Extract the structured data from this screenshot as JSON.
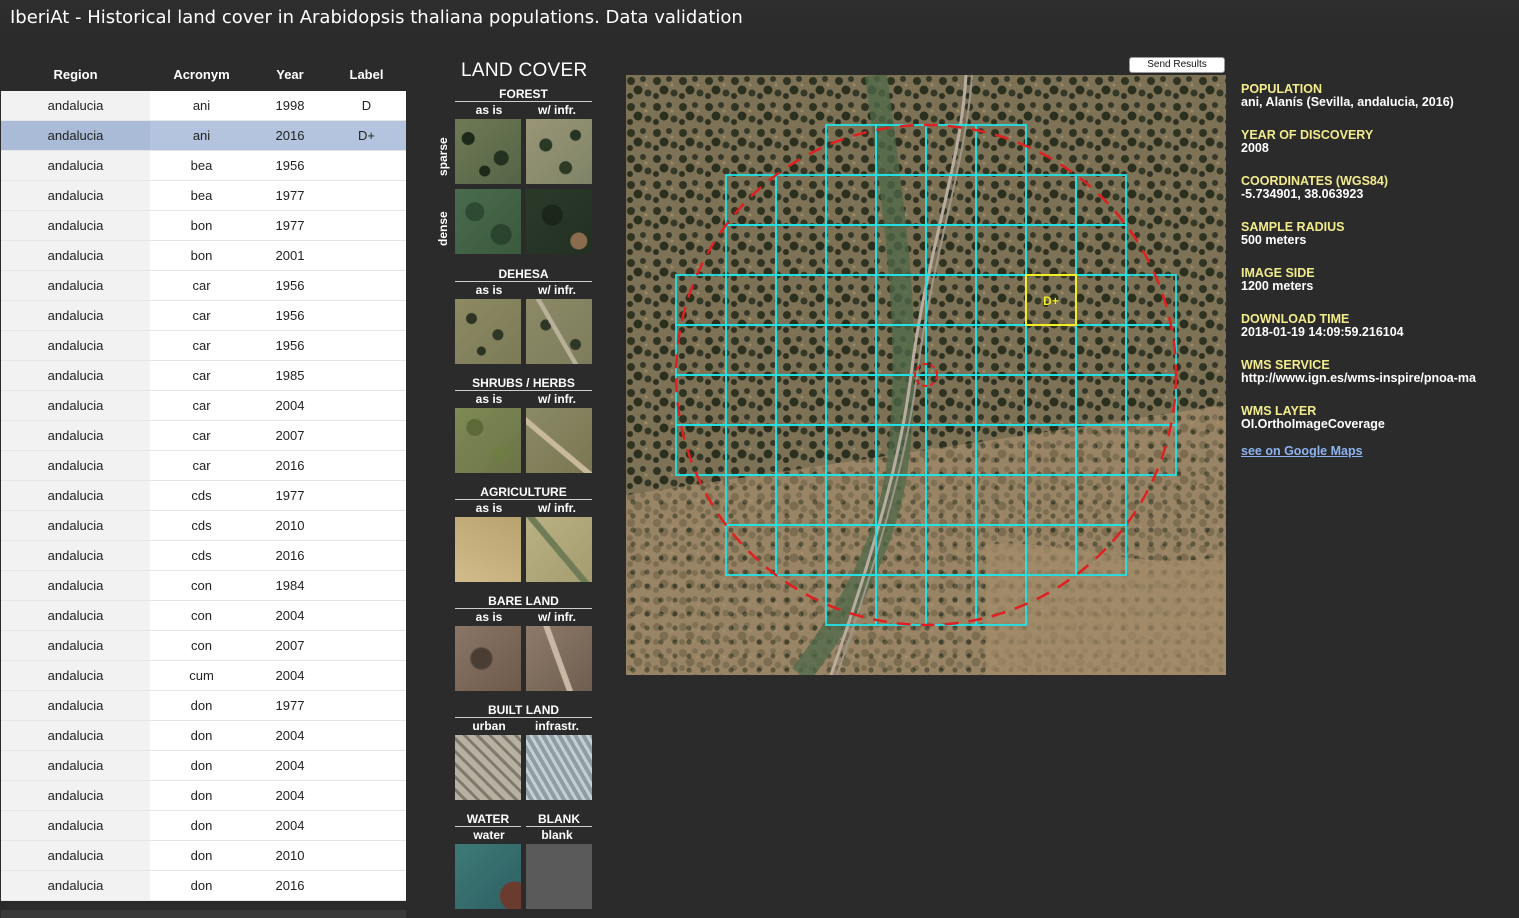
{
  "title": "IberiAt - Historical land cover in Arabidopsis thaliana populations. Data validation",
  "table": {
    "headers": {
      "region": "Region",
      "acronym": "Acronym",
      "year": "Year",
      "label": "Label"
    },
    "selected_index": 1,
    "rows": [
      {
        "region": "andalucia",
        "acronym": "ani",
        "year": "1998",
        "label": "D"
      },
      {
        "region": "andalucia",
        "acronym": "ani",
        "year": "2016",
        "label": "D+"
      },
      {
        "region": "andalucia",
        "acronym": "bea",
        "year": "1956",
        "label": ""
      },
      {
        "region": "andalucia",
        "acronym": "bea",
        "year": "1977",
        "label": ""
      },
      {
        "region": "andalucia",
        "acronym": "bon",
        "year": "1977",
        "label": ""
      },
      {
        "region": "andalucia",
        "acronym": "bon",
        "year": "2001",
        "label": ""
      },
      {
        "region": "andalucia",
        "acronym": "car",
        "year": "1956",
        "label": ""
      },
      {
        "region": "andalucia",
        "acronym": "car",
        "year": "1956",
        "label": ""
      },
      {
        "region": "andalucia",
        "acronym": "car",
        "year": "1956",
        "label": ""
      },
      {
        "region": "andalucia",
        "acronym": "car",
        "year": "1985",
        "label": ""
      },
      {
        "region": "andalucia",
        "acronym": "car",
        "year": "2004",
        "label": ""
      },
      {
        "region": "andalucia",
        "acronym": "car",
        "year": "2007",
        "label": ""
      },
      {
        "region": "andalucia",
        "acronym": "car",
        "year": "2016",
        "label": ""
      },
      {
        "region": "andalucia",
        "acronym": "cds",
        "year": "1977",
        "label": ""
      },
      {
        "region": "andalucia",
        "acronym": "cds",
        "year": "2010",
        "label": ""
      },
      {
        "region": "andalucia",
        "acronym": "cds",
        "year": "2016",
        "label": ""
      },
      {
        "region": "andalucia",
        "acronym": "con",
        "year": "1984",
        "label": ""
      },
      {
        "region": "andalucia",
        "acronym": "con",
        "year": "2004",
        "label": ""
      },
      {
        "region": "andalucia",
        "acronym": "con",
        "year": "2007",
        "label": ""
      },
      {
        "region": "andalucia",
        "acronym": "cum",
        "year": "2004",
        "label": ""
      },
      {
        "region": "andalucia",
        "acronym": "don",
        "year": "1977",
        "label": ""
      },
      {
        "region": "andalucia",
        "acronym": "don",
        "year": "2004",
        "label": ""
      },
      {
        "region": "andalucia",
        "acronym": "don",
        "year": "2004",
        "label": ""
      },
      {
        "region": "andalucia",
        "acronym": "don",
        "year": "2004",
        "label": ""
      },
      {
        "region": "andalucia",
        "acronym": "don",
        "year": "2004",
        "label": ""
      },
      {
        "region": "andalucia",
        "acronym": "don",
        "year": "2010",
        "label": ""
      },
      {
        "region": "andalucia",
        "acronym": "don",
        "year": "2016",
        "label": ""
      }
    ]
  },
  "land_cover": {
    "title": "LAND COVER",
    "row_labels": {
      "sparse": "sparse",
      "dense": "dense"
    },
    "forest": {
      "title": "FOREST",
      "sub_a": "as is",
      "sub_b": "w/ infr."
    },
    "dehesa": {
      "title": "DEHESA",
      "sub_a": "as is",
      "sub_b": "w/ infr."
    },
    "shrubs": {
      "title": "SHRUBS / HERBS",
      "sub_a": "as is",
      "sub_b": "w/ infr."
    },
    "agriculture": {
      "title": "AGRICULTURE",
      "sub_a": "as is",
      "sub_b": "w/ infr."
    },
    "bare": {
      "title": "BARE LAND",
      "sub_a": "as is",
      "sub_b": "w/ infr."
    },
    "built": {
      "title": "BUILT LAND",
      "sub_a": "urban",
      "sub_b": "infrastr."
    },
    "water": {
      "title": "WATER",
      "sub": "water"
    },
    "blank": {
      "title": "BLANK",
      "sub": "blank"
    }
  },
  "send_button": "Send Results",
  "map": {
    "cell_label": "D+",
    "grid_color": "#22e3e6",
    "circle_color": "#e02020",
    "highlight_color": "#f2ee22"
  },
  "info": {
    "population": {
      "key": "POPULATION",
      "value": "ani, Alanís (Sevilla, andalucia, 2016)"
    },
    "year": {
      "key": "YEAR OF DISCOVERY",
      "value": "2008"
    },
    "coords": {
      "key": "COORDINATES (WGS84)",
      "value": "-5.734901, 38.063923"
    },
    "radius": {
      "key": "SAMPLE RADIUS",
      "value": "500 meters"
    },
    "side": {
      "key": "IMAGE SIDE",
      "value": "1200 meters"
    },
    "download": {
      "key": "DOWNLOAD TIME",
      "value": "2018-01-19 14:09:59.216104"
    },
    "wms_service": {
      "key": "WMS SERVICE",
      "value": "http://www.ign.es/wms-inspire/pnoa-ma"
    },
    "wms_layer": {
      "key": "WMS LAYER",
      "value": "OI.OrthoImageCoverage"
    },
    "link": "see on Google Maps"
  }
}
